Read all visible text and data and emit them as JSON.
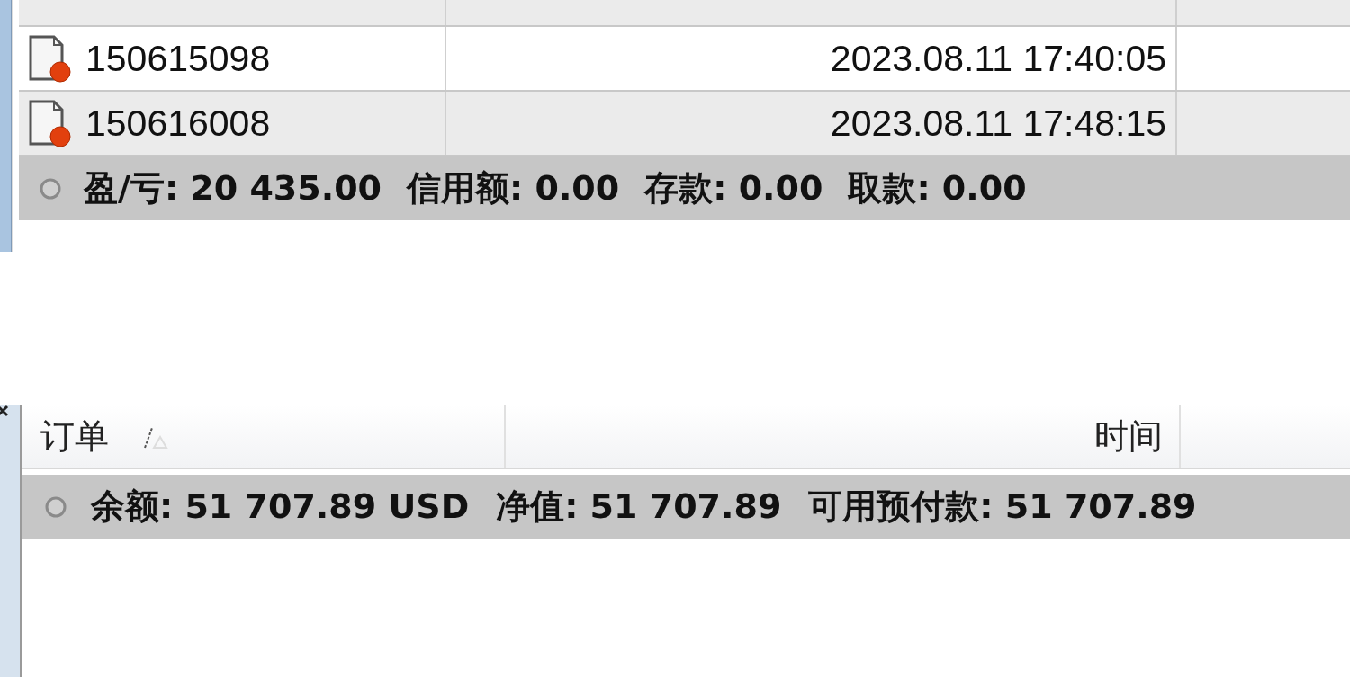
{
  "history_panel": {
    "rows": [
      {
        "order": "150615098",
        "time": "2023.08.11 17:40:05"
      },
      {
        "order": "150616008",
        "time": "2023.08.11 17:48:15"
      }
    ],
    "summary": [
      "盈/亏: 20 435.00",
      "信用额: 0.00",
      "存款: 0.00",
      "取款: 0.00"
    ]
  },
  "trade_panel": {
    "columns": [
      "订单",
      "时间"
    ],
    "summary": [
      "余额: 51 707.89 USD",
      "净值: 51 707.89",
      "可用预付款: 51 707.89"
    ]
  }
}
